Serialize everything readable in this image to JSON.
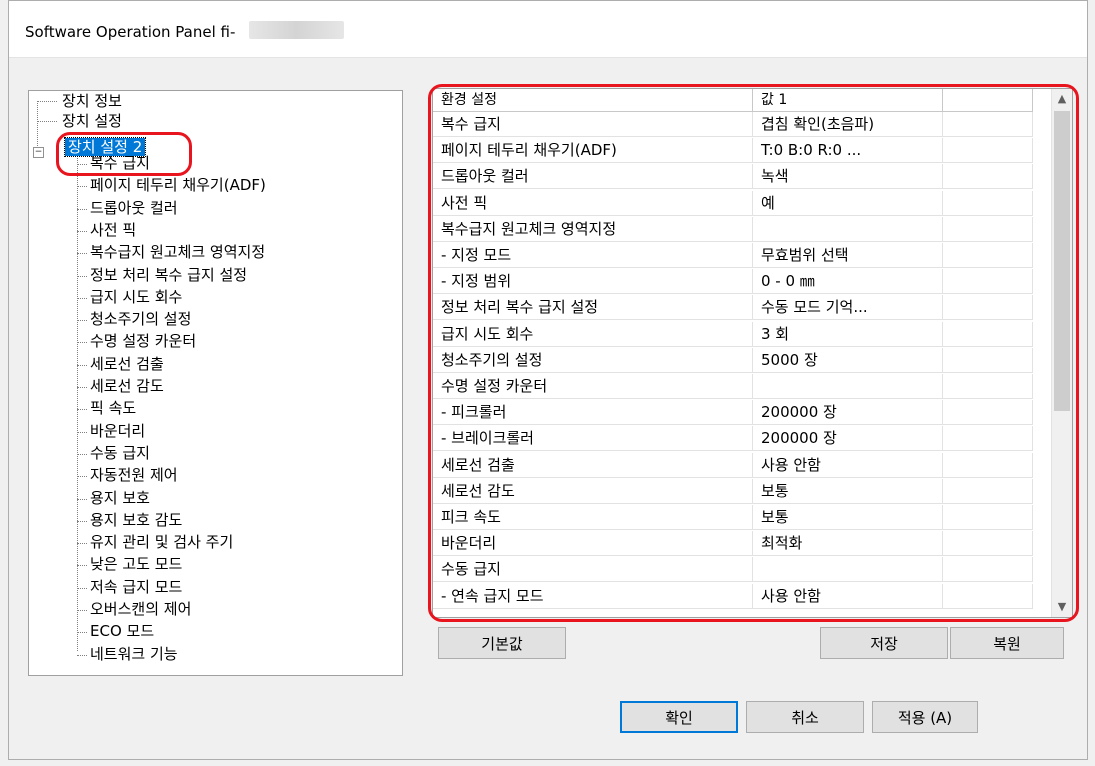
{
  "window": {
    "title": "Software Operation Panel fi-"
  },
  "tree": {
    "items": [
      {
        "label": "장치 정보"
      },
      {
        "label": "장치 설정"
      },
      {
        "label": "장치 설정 2"
      },
      {
        "label": "복수 급지"
      },
      {
        "label": "페이지 테두리 채우기(ADF)"
      },
      {
        "label": "드롭아웃 컬러"
      },
      {
        "label": "사전 픽"
      },
      {
        "label": "복수급지 원고체크 영역지정"
      },
      {
        "label": "정보 처리 복수 급지 설정"
      },
      {
        "label": "급지 시도 회수"
      },
      {
        "label": "청소주기의 설정"
      },
      {
        "label": "수명 설정 카운터"
      },
      {
        "label": "세로선 검출"
      },
      {
        "label": "세로선 감도"
      },
      {
        "label": "픽 속도"
      },
      {
        "label": "바운더리"
      },
      {
        "label": "수동 급지"
      },
      {
        "label": "자동전원 제어"
      },
      {
        "label": "용지 보호"
      },
      {
        "label": "용지 보호 감도"
      },
      {
        "label": "유지 관리 및 검사 주기"
      },
      {
        "label": "낮은 고도 모드"
      },
      {
        "label": "저속 급지 모드"
      },
      {
        "label": "오버스캔의 제어"
      },
      {
        "label": "ECO 모드"
      },
      {
        "label": "네트워크 기능"
      }
    ]
  },
  "grid": {
    "headers": [
      "환경 설정",
      "값 1",
      ""
    ],
    "rows": [
      {
        "name": "복수 급지",
        "value": "겹침 확인(초음파)"
      },
      {
        "name": "페이지 테두리 채우기(ADF)",
        "value": "T:0  B:0  R:0  ..."
      },
      {
        "name": "드롭아웃 컬러",
        "value": "녹색"
      },
      {
        "name": "사전 픽",
        "value": "예"
      },
      {
        "name": "복수급지 원고체크 영역지정",
        "value": ""
      },
      {
        "name": " - 지정 모드",
        "value": "무효범위 선택"
      },
      {
        "name": " - 지정 범위",
        "value": "0 - 0 ㎜"
      },
      {
        "name": "정보 처리 복수 급지 설정",
        "value": "수동 모드  기억..."
      },
      {
        "name": "급지 시도 회수",
        "value": "3 회"
      },
      {
        "name": "청소주기의 설정",
        "value": "5000 장"
      },
      {
        "name": "수명 설정 카운터",
        "value": ""
      },
      {
        "name": " - 피크롤러",
        "value": "200000 장"
      },
      {
        "name": " - 브레이크롤러",
        "value": "200000 장"
      },
      {
        "name": "세로선 검출",
        "value": "사용 안함"
      },
      {
        "name": "세로선 감도",
        "value": "보통"
      },
      {
        "name": "피크 속도",
        "value": "보통"
      },
      {
        "name": "바운더리",
        "value": "최적화"
      },
      {
        "name": "수동 급지",
        "value": ""
      },
      {
        "name": " - 연속 급지 모드",
        "value": "사용 안함"
      }
    ]
  },
  "buttons": {
    "default": "기본값",
    "save": "저장",
    "restore": "복원",
    "ok": "확인",
    "cancel": "취소",
    "apply": "적용 (A)"
  },
  "colors": {
    "highlight": "#e8141e",
    "selection": "#0078d7"
  }
}
